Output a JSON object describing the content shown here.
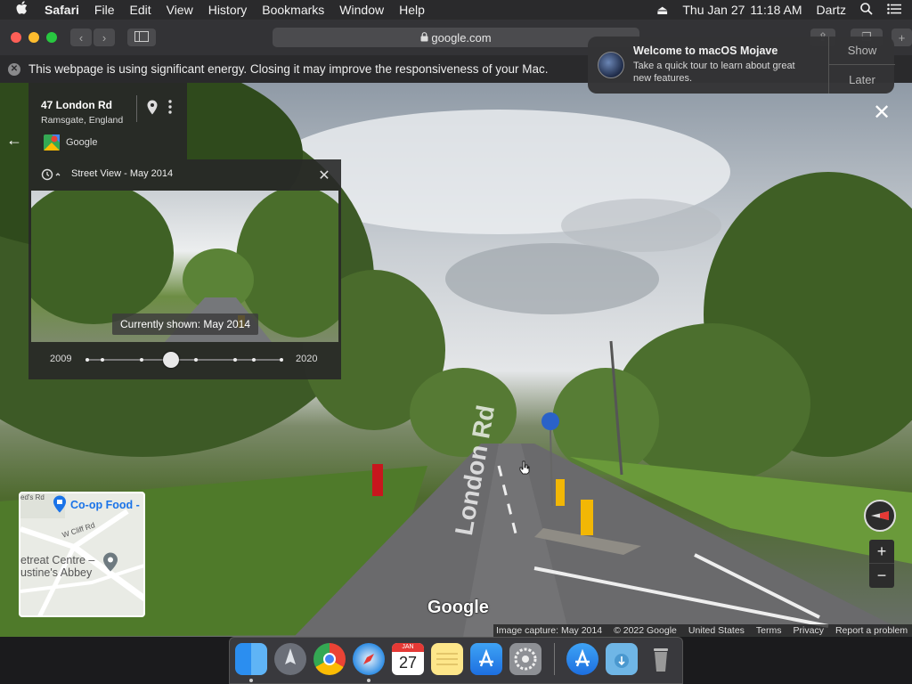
{
  "menubar": {
    "app": "Safari",
    "items": [
      "File",
      "Edit",
      "View",
      "History",
      "Bookmarks",
      "Window",
      "Help"
    ],
    "date": "Thu Jan 27",
    "time": "11:18 AM",
    "user": "Dartz"
  },
  "browser": {
    "url": "google.com"
  },
  "energy_banner": {
    "message": "This webpage is using significant energy. Closing it may improve the responsiveness of your Mac."
  },
  "notification": {
    "title": "Welcome to macOS Mojave",
    "body_line1": "Take a quick tour to learn about great",
    "body_line2": "new features.",
    "show_label": "Show",
    "later_label": "Later"
  },
  "location": {
    "address": "47 London Rd",
    "region": "Ramsgate, England",
    "source": "Google"
  },
  "timeline": {
    "header": "Street View - May 2014",
    "tooltip": "Currently shown: May 2014",
    "start_year": "2009",
    "end_year": "2020",
    "selected_fraction": 0.43
  },
  "minimap": {
    "poi1": "Co-op Food -",
    "street1": "ed's Rd",
    "street2": "W Cliff Rd",
    "poi2_line1": "etreat Centre –",
    "poi2_line2": "ustine's Abbey"
  },
  "scene": {
    "road_label": "London Rd",
    "watermark": "Google"
  },
  "footer": {
    "capture": "Image capture: May 2014",
    "copyright": "© 2022 Google",
    "country": "United States",
    "terms": "Terms",
    "privacy": "Privacy",
    "report": "Report a problem"
  },
  "dock": {
    "calendar_month": "JAN",
    "calendar_day": "27"
  },
  "colors": {
    "menubar": "#2a2a2c",
    "toolbar": "#333336",
    "panel": "#282828",
    "accent_blue": "#1a73e8"
  }
}
